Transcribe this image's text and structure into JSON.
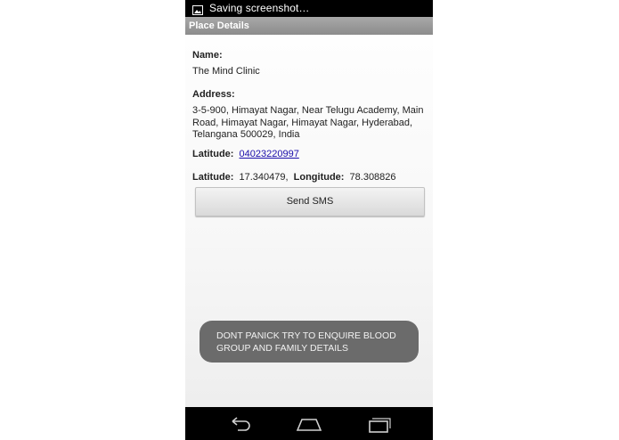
{
  "status_bar": {
    "notification_text": "Saving screenshot…",
    "icon": "image-icon"
  },
  "title_bar": {
    "title": "Place Details"
  },
  "place": {
    "name_label": "Name:",
    "name_value": "The Mind Clinic",
    "address_label": "Address:",
    "address_value": "3-5-900, Himayat Nagar, Near Telugu Academy, Main Road, Himayat Nagar, Himayat Nagar, Hyderabad, Telangana 500029, India",
    "phone_label": "Latitude:",
    "phone_value": "04023220997",
    "lat_label": "Latitude:",
    "lat_value": "17.340479",
    "separator": ",",
    "lng_label": "Longitude:",
    "lng_value": "78.308826"
  },
  "actions": {
    "send_sms_label": "Send SMS"
  },
  "toast": {
    "message": "DONT PANICK TRY TO ENQUIRE BLOOD GROUP AND FAMILY DETAILS"
  },
  "nav_bar": {
    "back_icon": "back-icon",
    "home_icon": "home-icon",
    "recents_icon": "recents-icon"
  }
}
